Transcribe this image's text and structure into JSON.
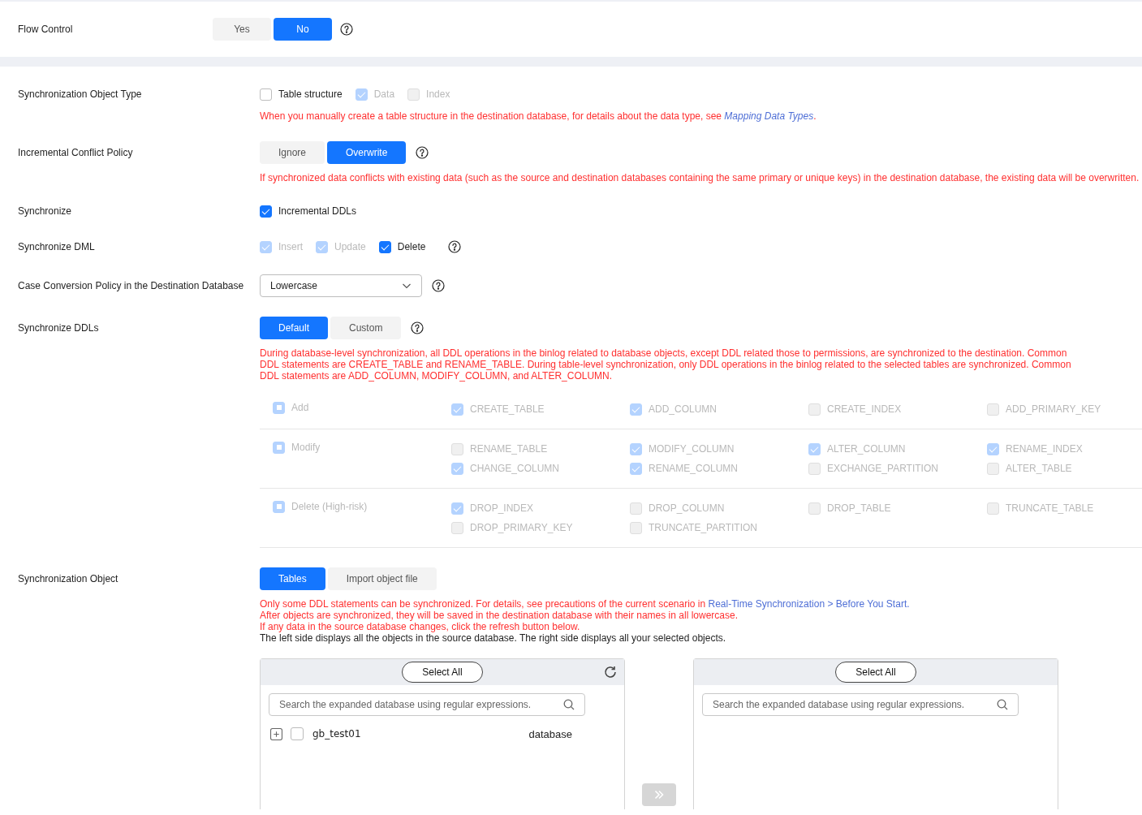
{
  "flow_control": {
    "label": "Flow Control",
    "help": true,
    "options": [
      {
        "label": "Yes",
        "selected": false
      },
      {
        "label": "No",
        "selected": true
      }
    ]
  },
  "rows": [
    {
      "label": "Synchronization Object Type",
      "kind": "checkboxes",
      "options": [
        {
          "label": "Table structure",
          "checked": false,
          "disabled": false
        },
        {
          "label": "Data",
          "checked": true,
          "disabled": true
        },
        {
          "label": "Index",
          "checked": false,
          "disabled": true
        }
      ],
      "notes": [
        {
          "kind": "warning",
          "parts": [
            {
              "kind": "text",
              "text": "When you manually create a table structure in the destination database, for details about the data type, see "
            },
            {
              "kind": "link",
              "text": "Mapping Data Types",
              "italic": true
            },
            {
              "kind": "text",
              "text": "."
            }
          ]
        }
      ]
    },
    {
      "label": "Incremental Conflict Policy",
      "kind": "segmented",
      "help": true,
      "options": [
        {
          "label": "Ignore",
          "selected": false
        },
        {
          "label": "Overwrite",
          "selected": true
        }
      ],
      "notes": [
        {
          "kind": "warning",
          "parts": [
            {
              "kind": "text",
              "text": "If synchronized data conflicts with existing data (such as the source and destination databases containing the same primary or unique keys) in the destination database, the existing data will be overwritten."
            }
          ]
        }
      ]
    },
    {
      "label": "Synchronize",
      "kind": "checkboxes",
      "options": [
        {
          "label": "Incremental DDLs",
          "checked": true,
          "disabled": false
        }
      ]
    },
    {
      "label": "Synchronize DML",
      "kind": "checkboxes",
      "help": true,
      "options": [
        {
          "label": "Insert",
          "checked": true,
          "disabled": true
        },
        {
          "label": "Update",
          "checked": true,
          "disabled": true
        },
        {
          "label": "Delete",
          "checked": true,
          "disabled": false
        }
      ]
    },
    {
      "label": "Case Conversion Policy in the Destination Database",
      "kind": "select",
      "help": true,
      "value": "Lowercase"
    },
    {
      "label": "Synchronize DDLs",
      "kind": "segmented",
      "help": true,
      "options": [
        {
          "label": "Default",
          "selected": true
        },
        {
          "label": "Custom",
          "selected": false
        }
      ],
      "notes": [
        {
          "kind": "warning",
          "parts": [
            {
              "kind": "text",
              "text": "During database-level synchronization, all DDL operations in the binlog related to database objects, except DDL related those to permissions, are synchronized to the destination. Common DDL statements are CREATE_TABLE and RENAME_TABLE. During table-level synchronization, only DDL operations in the binlog related to the selected tables are synchronized. Common DDL statements are ADD_COLUMN, MODIFY_COLUMN, and ALTER_COLUMN."
            }
          ]
        }
      ],
      "ddl_groups": [
        {
          "label": "Add",
          "indeterminate": true,
          "disabled": true,
          "items": [
            {
              "label": "CREATE_TABLE",
              "checked": true
            },
            {
              "label": "ADD_COLUMN",
              "checked": true
            },
            {
              "label": "CREATE_INDEX",
              "checked": false
            },
            {
              "label": "ADD_PRIMARY_KEY",
              "checked": false
            }
          ]
        },
        {
          "label": "Modify",
          "indeterminate": true,
          "disabled": true,
          "items": [
            {
              "label": "RENAME_TABLE",
              "checked": false
            },
            {
              "label": "MODIFY_COLUMN",
              "checked": true
            },
            {
              "label": "ALTER_COLUMN",
              "checked": true
            },
            {
              "label": "RENAME_INDEX",
              "checked": true
            },
            {
              "label": "CHANGE_COLUMN",
              "checked": true
            },
            {
              "label": "RENAME_COLUMN",
              "checked": true
            },
            {
              "label": "EXCHANGE_PARTITION",
              "checked": false
            },
            {
              "label": "ALTER_TABLE",
              "checked": false
            }
          ]
        },
        {
          "label": "Delete (High-risk)",
          "indeterminate": true,
          "disabled": true,
          "items": [
            {
              "label": "DROP_INDEX",
              "checked": true
            },
            {
              "label": "DROP_COLUMN",
              "checked": false
            },
            {
              "label": "DROP_TABLE",
              "checked": false
            },
            {
              "label": "TRUNCATE_TABLE",
              "checked": false
            },
            {
              "label": "DROP_PRIMARY_KEY",
              "checked": false
            },
            {
              "label": "TRUNCATE_PARTITION",
              "checked": false
            }
          ]
        }
      ]
    },
    {
      "label": "Synchronization Object",
      "kind": "segmented",
      "options": [
        {
          "label": "Tables",
          "selected": true
        },
        {
          "label": "Import object file",
          "selected": false
        }
      ],
      "notes": [
        {
          "kind": "warning",
          "parts": [
            {
              "kind": "text",
              "text": "Only some DDL statements can be synchronized. For details, see precautions of the current scenario in "
            },
            {
              "kind": "link",
              "text": "Real-Time Synchronization",
              "italic": false
            },
            {
              "kind": "separator",
              "text": " > "
            },
            {
              "kind": "link",
              "text": "Before You Start",
              "italic": false
            },
            {
              "kind": "separator",
              "text": "."
            }
          ]
        },
        {
          "kind": "warning",
          "parts": [
            {
              "kind": "text",
              "text": "After objects are synchronized, they will be saved in the destination database with their names in all lowercase."
            }
          ]
        },
        {
          "kind": "warning",
          "parts": [
            {
              "kind": "text",
              "text": "If any data in the source database changes, click the refresh button below."
            }
          ]
        },
        {
          "kind": "info",
          "parts": [
            {
              "kind": "text",
              "text": "The left side displays all the objects in the source database. The right side displays all your selected objects."
            }
          ]
        }
      ],
      "transfer": {
        "source": {
          "select_all": "Select All",
          "refresh": true,
          "search_placeholder": "Search the expanded database using regular expressions.",
          "items": [
            {
              "name": "gb_test01",
              "type": "database",
              "expanded": false,
              "checked": false
            }
          ]
        },
        "move_button": {
          "disabled": true
        },
        "target": {
          "select_all": "Select All",
          "search_placeholder": "Search the expanded database using regular expressions."
        }
      }
    }
  ]
}
